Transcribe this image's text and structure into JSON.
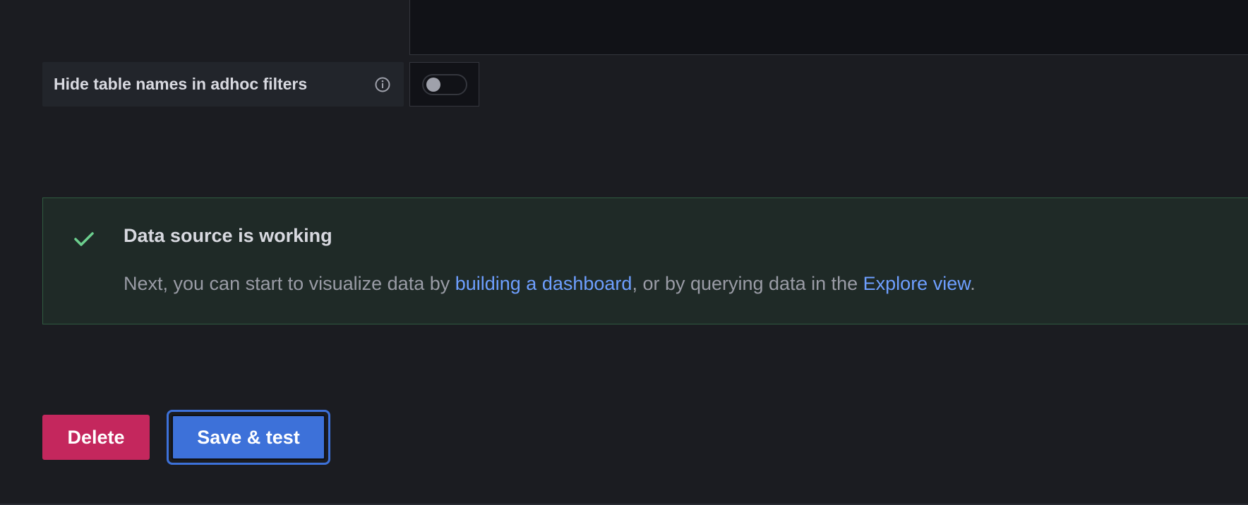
{
  "settings": {
    "hide_table_names": {
      "label": "Hide table names in adhoc filters",
      "info_icon": "info-circle-icon",
      "enabled": false
    }
  },
  "alert": {
    "status": "success",
    "icon": "check-icon",
    "title": "Data source is working",
    "body_prefix": "Next, you can start to visualize data by ",
    "link_dashboard": "building a dashboard",
    "body_middle": ", or by querying data in the ",
    "link_explore": "Explore view",
    "body_suffix": "."
  },
  "actions": {
    "delete_label": "Delete",
    "save_label": "Save & test"
  },
  "colors": {
    "background": "#1b1c21",
    "success_border": "#2f5a40",
    "success_icon": "#6ccf8e",
    "link": "#6e9fff",
    "delete": "#c4275d",
    "primary": "#3d71d9"
  }
}
